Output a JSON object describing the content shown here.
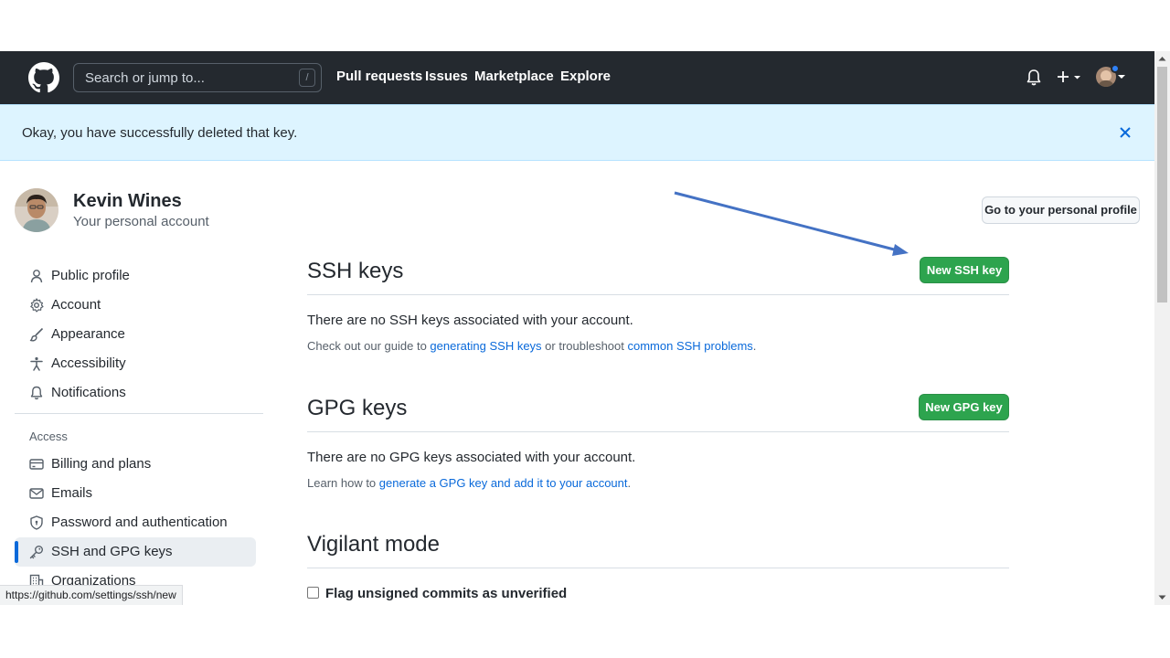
{
  "header": {
    "search_placeholder": "Search or jump to...",
    "search_shortcut": "/",
    "nav": [
      "Pull requests",
      "Issues",
      "Marketplace",
      "Explore"
    ]
  },
  "flash": {
    "message": "Okay, you have successfully deleted that key."
  },
  "account": {
    "name": "Kevin Wines",
    "subtitle": "Your personal account",
    "profile_button": "Go to your personal profile"
  },
  "sidebar": {
    "items": [
      {
        "label": "Public profile",
        "icon": "person-icon"
      },
      {
        "label": "Account",
        "icon": "gear-icon"
      },
      {
        "label": "Appearance",
        "icon": "paintbrush-icon"
      },
      {
        "label": "Accessibility",
        "icon": "accessibility-icon"
      },
      {
        "label": "Notifications",
        "icon": "bell-icon"
      }
    ],
    "access_heading": "Access",
    "access_items": [
      {
        "label": "Billing and plans",
        "icon": "credit-card-icon"
      },
      {
        "label": "Emails",
        "icon": "mail-icon"
      },
      {
        "label": "Password and authentication",
        "icon": "shield-lock-icon"
      },
      {
        "label": "SSH and GPG keys",
        "icon": "key-icon",
        "active": true
      },
      {
        "label": "Organizations",
        "icon": "organization-icon"
      }
    ]
  },
  "ssh": {
    "title": "SSH keys",
    "button": "New SSH key",
    "empty": "There are no SSH keys associated with your account.",
    "help_prefix": "Check out our guide to ",
    "help_link1": "generating SSH keys",
    "help_mid": " or troubleshoot ",
    "help_link2": "common SSH problems",
    "help_suffix": "."
  },
  "gpg": {
    "title": "GPG keys",
    "button": "New GPG key",
    "empty": "There are no GPG keys associated with your account.",
    "help_prefix": "Learn how to ",
    "help_link": "generate a GPG key and add it to your account",
    "help_suffix": "."
  },
  "vigilant": {
    "title": "Vigilant mode",
    "checkbox_label": "Flag unsigned commits as unverified",
    "checked": false
  },
  "status_bar": {
    "url": "https://github.com/settings/ssh/new"
  },
  "colors": {
    "header_bg": "#24292f",
    "flash_bg": "#ddf4ff",
    "primary_button": "#2da44e",
    "link": "#0969da",
    "annotation_arrow": "#4472c4"
  }
}
